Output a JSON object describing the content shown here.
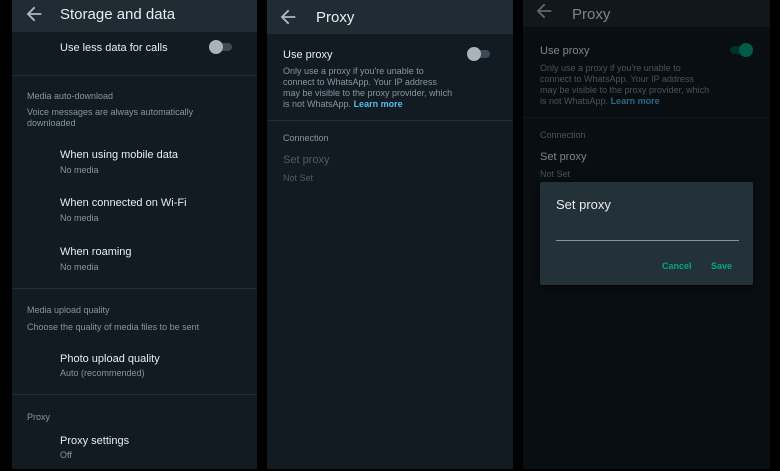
{
  "colors": {
    "background": "#121b22",
    "appbar": "#1f2c33",
    "accent_green": "#00a884",
    "link_blue": "#53bdeb",
    "primary_text": "#e9edef",
    "secondary_text": "#8696a0"
  },
  "storage_screen": {
    "title": "Storage and data",
    "less_data_label": "Use less data for calls",
    "less_data_enabled": false,
    "media_auto_download": {
      "heading": "Media auto-download",
      "note": "Voice messages are always automatically downloaded",
      "items": [
        {
          "title": "When using mobile data",
          "value": "No media"
        },
        {
          "title": "When connected on Wi-Fi",
          "value": "No media"
        },
        {
          "title": "When roaming",
          "value": "No media"
        }
      ]
    },
    "media_upload": {
      "heading": "Media upload quality",
      "note": "Choose the quality of media files to be sent",
      "photo_title": "Photo upload quality",
      "photo_value": "Auto (recommended)"
    },
    "proxy": {
      "heading": "Proxy",
      "settings_title": "Proxy settings",
      "settings_value": "Off"
    }
  },
  "proxy_screen": {
    "title": "Proxy",
    "use_proxy_label": "Use proxy",
    "use_proxy_enabled": false,
    "description_lines": [
      "Only use a proxy if you're unable to",
      "connect to WhatsApp. Your IP address",
      "may be visible to the proxy provider, which",
      "is not WhatsApp."
    ],
    "learn_more": "Learn more",
    "connection_heading": "Connection",
    "set_proxy_label": "Set proxy",
    "set_proxy_value": "Not Set"
  },
  "proxy_dialog_screen": {
    "title": "Proxy",
    "use_proxy_label": "Use proxy",
    "use_proxy_enabled": true,
    "description_lines": [
      "Only use a proxy if you're unable to",
      "connect to WhatsApp. Your IP address",
      "may be visible to the proxy provider, which",
      "is not WhatsApp."
    ],
    "learn_more": "Learn more",
    "connection_heading": "Connection",
    "set_proxy_label": "Set proxy",
    "set_proxy_value": "Not Set",
    "dialog": {
      "title": "Set proxy",
      "input_value": "",
      "cancel_label": "Cancel",
      "save_label": "Save"
    }
  }
}
